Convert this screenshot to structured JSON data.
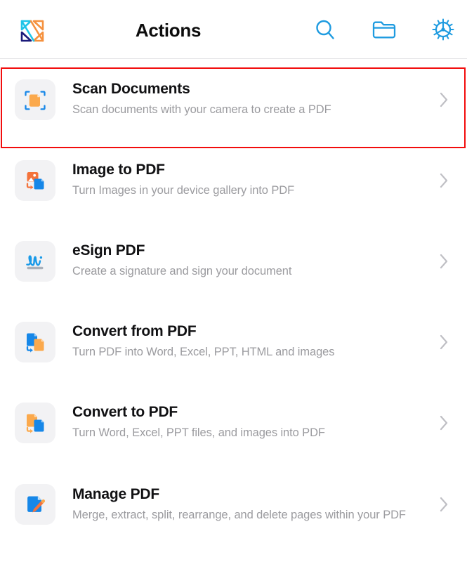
{
  "header": {
    "logo_name": "xodo-logo",
    "title": "Actions",
    "icons": [
      {
        "name": "search-icon",
        "label": "Search"
      },
      {
        "name": "folder-icon",
        "label": "Folder"
      },
      {
        "name": "settings-gear-icon",
        "label": "Settings"
      }
    ]
  },
  "colors": {
    "accent_blue": "#1E9BE0",
    "icon_blue": "#1687E8",
    "icon_orange": "#FBA94C",
    "icon_orange_deep": "#F4733B",
    "logo_cyan": "#1FC4E8",
    "logo_orange": "#F5913E",
    "logo_navy": "#1B1A7A",
    "tile_bg": "#F2F2F4",
    "title_text": "#111113",
    "sub_text": "#9B9B9F",
    "chevron": "#BFBFC4",
    "highlight_border": "#F20D0D",
    "header_border": "#E3E3E5"
  },
  "highlight": {
    "name": "scan-documents-highlight",
    "target": "Scan Documents"
  },
  "list": {
    "items": [
      {
        "id": "scan-documents",
        "title": "Scan Documents",
        "subtitle": "Scan documents with your camera to create a PDF",
        "icon": "scan-document-icon"
      },
      {
        "id": "image-to-pdf",
        "title": "Image to PDF",
        "subtitle": "Turn Images in your device gallery into PDF",
        "icon": "image-to-pdf-icon"
      },
      {
        "id": "esign-pdf",
        "title": "eSign PDF",
        "subtitle": "Create a signature and sign your document",
        "icon": "signature-icon"
      },
      {
        "id": "convert-from-pdf",
        "title": "Convert from PDF",
        "subtitle": "Turn PDF into Word, Excel, PPT, HTML and images",
        "icon": "convert-from-pdf-icon"
      },
      {
        "id": "convert-to-pdf",
        "title": "Convert to PDF",
        "subtitle": "Turn Word, Excel, PPT files, and images into PDF",
        "icon": "convert-to-pdf-icon"
      },
      {
        "id": "manage-pdf",
        "title": "Manage PDF",
        "subtitle": "Merge, extract, split, rearrange, and delete pages within your PDF",
        "icon": "manage-pdf-icon"
      }
    ]
  }
}
